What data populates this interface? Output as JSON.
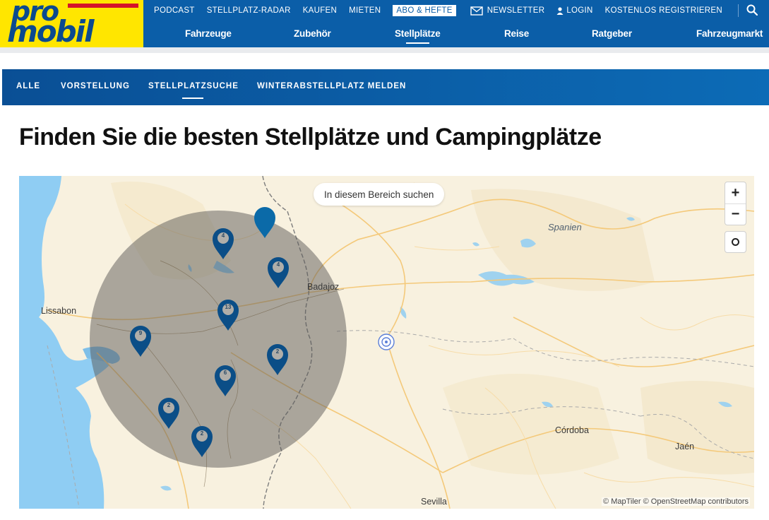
{
  "brand": {
    "logo_top": "pro",
    "logo_bottom": "mobil",
    "colors": {
      "blue": "#0b5ea8",
      "yellow": "#ffe600",
      "red": "#d4142a",
      "pin": "#0b4e87"
    }
  },
  "topnav": {
    "podcast": "PODCAST",
    "radar": "STELLPLATZ-RADAR",
    "kaufen": "KAUFEN",
    "mieten": "MIETEN",
    "abo": "ABO & HEFTE",
    "newsletter": "NEWSLETTER",
    "login": "LOGIN",
    "register": "KOSTENLOS REGISTRIEREN",
    "icons": {
      "newsletter": "envelope-icon",
      "login": "user-icon",
      "search": "search-icon"
    }
  },
  "mainnav": {
    "items": [
      {
        "label": "Fahrzeuge",
        "active": false
      },
      {
        "label": "Zubehör",
        "active": false
      },
      {
        "label": "Stellplätze",
        "active": true
      },
      {
        "label": "Reise",
        "active": false
      },
      {
        "label": "Ratgeber",
        "active": false
      },
      {
        "label": "Fahrzeugmarkt",
        "active": false
      }
    ]
  },
  "subnav": {
    "items": [
      {
        "label": "ALLE",
        "active": false
      },
      {
        "label": "VORSTELLUNG",
        "active": false
      },
      {
        "label": "STELLPLATZSUCHE",
        "active": true
      },
      {
        "label": "WINTERABSTELLPLATZ MELDEN",
        "active": false
      }
    ]
  },
  "page": {
    "title": "Finden Sie die besten Stellplätze und Campingplätze"
  },
  "map": {
    "search_area_button": "In diesem Bereich suchen",
    "zoom_in": "+",
    "zoom_out": "−",
    "labels": {
      "spanien": "Spanien",
      "badajoz": "Badajoz",
      "lissabon": "Lissabon",
      "cordoba": "Córdoba",
      "jaen": "Jaén",
      "sevilla": "Sevilla"
    },
    "attribution": "© MapTiler © OpenStreetMap contributors",
    "clusters": [
      {
        "count": "4"
      },
      {
        "count": "4"
      },
      {
        "count": "13"
      },
      {
        "count": "9"
      },
      {
        "count": "2"
      },
      {
        "count": "6"
      },
      {
        "count": "2"
      },
      {
        "count": "2"
      }
    ]
  }
}
